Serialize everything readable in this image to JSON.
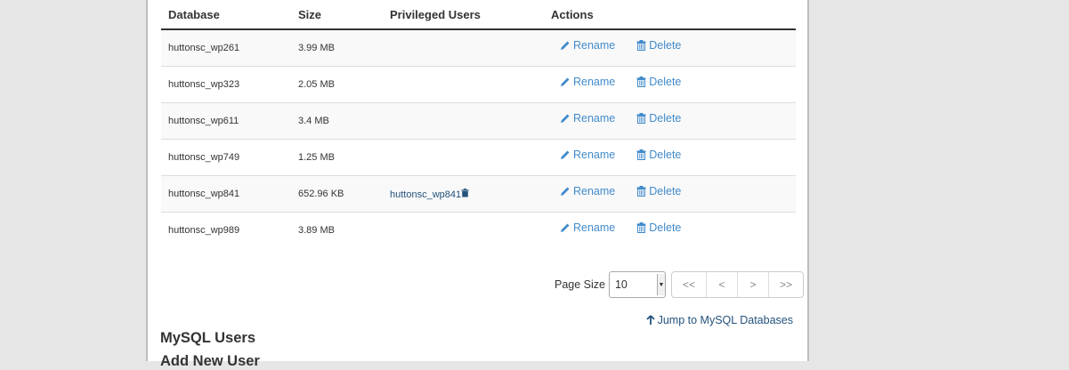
{
  "table": {
    "headers": {
      "database": "Database",
      "size": "Size",
      "privileged_users": "Privileged Users",
      "actions": "Actions"
    },
    "rows": [
      {
        "database": "huttonsc_wp261",
        "size": "3.99 MB",
        "user": ""
      },
      {
        "database": "huttonsc_wp323",
        "size": "2.05 MB",
        "user": ""
      },
      {
        "database": "huttonsc_wp611",
        "size": "3.4 MB",
        "user": ""
      },
      {
        "database": "huttonsc_wp749",
        "size": "1.25 MB",
        "user": ""
      },
      {
        "database": "huttonsc_wp841",
        "size": "652.96 KB",
        "user": "huttonsc_wp841"
      },
      {
        "database": "huttonsc_wp989",
        "size": "3.89 MB",
        "user": ""
      }
    ],
    "rename_label": "Rename",
    "delete_label": "Delete",
    "rename_icon": "pencil-icon",
    "delete_icon": "trash-icon"
  },
  "pagination": {
    "page_size_label": "Page Size",
    "page_size_value": "10",
    "first": "<<",
    "prev": "<",
    "next": ">",
    "last": ">>"
  },
  "jump_link": "Jump to MySQL Databases",
  "section_title": "MySQL Users",
  "subsection_title": "Add New User",
  "colors": {
    "link": "#428bca",
    "link_dark": "#23527c",
    "page_bg": "#e6e6e6"
  }
}
